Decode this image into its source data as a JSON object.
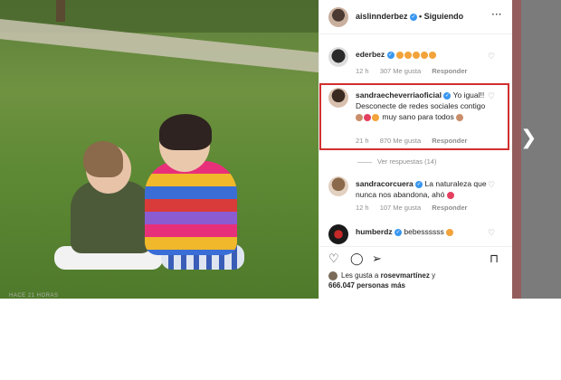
{
  "header": {
    "username": "aislinnderbez",
    "separator": "•",
    "follow_state": "Siguiendo",
    "more": "···"
  },
  "comments": [
    {
      "name": "ederbez",
      "text": "",
      "emoji_count": 5,
      "time": "12 h",
      "likes": "307 Me gusta",
      "reply": "Responder"
    },
    {
      "name": "sandraecheverriaoficial",
      "text": "Yo igual!! Desconecte de redes sociales contigo",
      "text2": "muy sano para todos",
      "time": "21 h",
      "likes": "870 Me gusta",
      "reply": "Responder"
    },
    {
      "name": "sandracorcuera",
      "text": "La naturaleza que nunca nos abandona, ahó",
      "time": "12 h",
      "likes": "107 Me gusta",
      "reply": "Responder"
    },
    {
      "name": "humberdz",
      "text": "bebessssss"
    }
  ],
  "view_replies": "Ver respuestas (14)",
  "likes": {
    "prefix": "Les gusta a",
    "user": "rosevmartínez",
    "suffix": "y",
    "count": "666.047",
    "count_suffix": "personas más"
  },
  "time_ago": "HACE 21 HORAS",
  "icons": {
    "heart": "heart-icon",
    "comment": "comment-icon",
    "share": "share-icon",
    "save": "bookmark-icon",
    "next": "chevron-right-icon"
  },
  "colors": {
    "highlight": "#d22f2f",
    "verified": "#3897f0",
    "heart_red": "#e4405f"
  }
}
